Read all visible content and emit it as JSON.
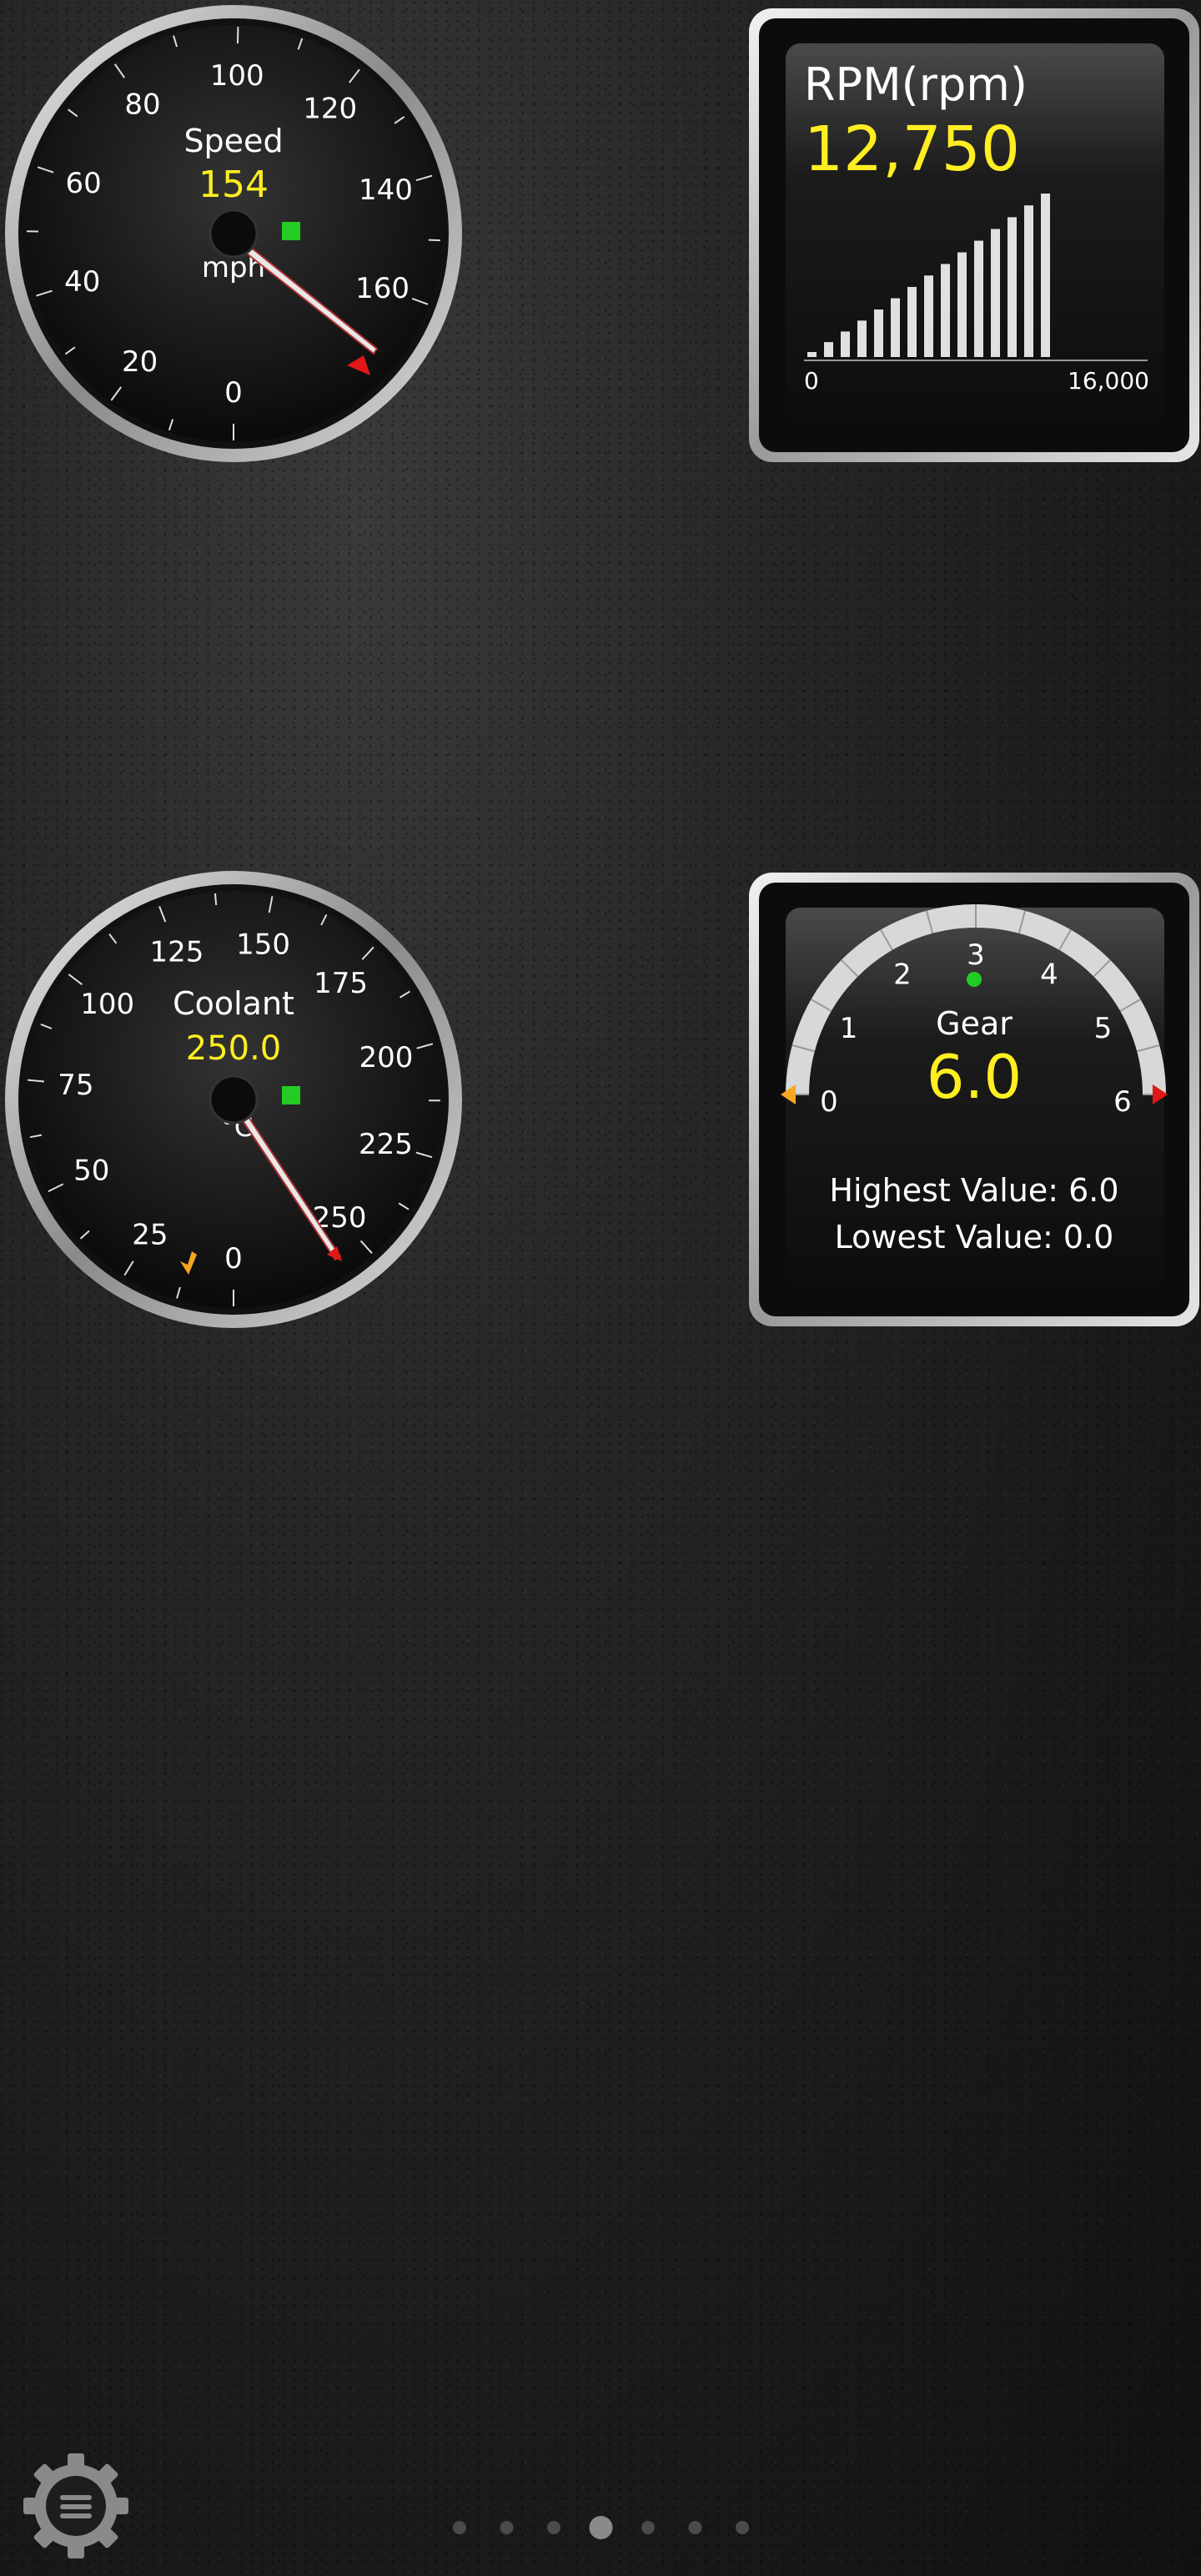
{
  "speed_gauge": {
    "label": "Speed",
    "value": "154",
    "unit": "mph",
    "scale_labels": [
      "0",
      "20",
      "40",
      "60",
      "80",
      "100",
      "120",
      "140",
      "160"
    ],
    "indicator_color": "#22cc22"
  },
  "rpm_gauge": {
    "title": "RPM(rpm)",
    "value": "12,750",
    "axis_min": "0",
    "axis_max": "16,000",
    "level_fraction": 0.797
  },
  "coolant_gauge": {
    "label": "Coolant",
    "value": "250.0",
    "unit": "°C",
    "scale_labels": [
      "0",
      "25",
      "50",
      "75",
      "100",
      "125",
      "150",
      "175",
      "200",
      "225",
      "250"
    ],
    "indicator_color": "#22cc22"
  },
  "gear_gauge": {
    "label": "Gear",
    "value": "6.0",
    "scale_labels": [
      "0",
      "1",
      "2",
      "3",
      "4",
      "5",
      "6"
    ],
    "highest": "Highest Value: 6.0",
    "lowest": "Lowest Value: 0.0"
  },
  "menu": {
    "icon": "settings-gear-menu-icon"
  },
  "pager": {
    "page_count": 7,
    "active_index": 3
  },
  "colors": {
    "value_yellow": "#ffee22",
    "needle_red": "#e01818",
    "marker_orange": "#f5a623"
  }
}
